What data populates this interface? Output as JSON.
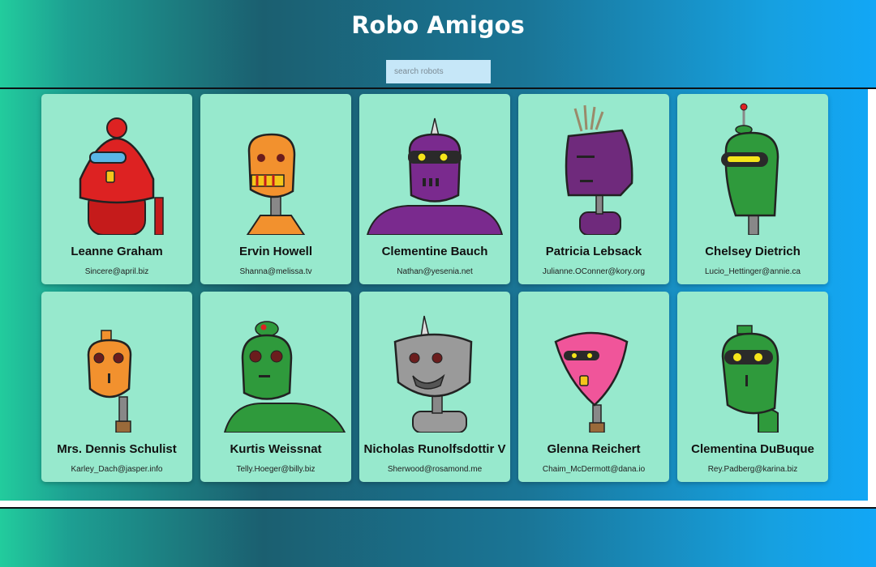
{
  "header": {
    "title": "Robo Amigos"
  },
  "search": {
    "placeholder": "search robots",
    "value": ""
  },
  "robots": [
    {
      "name": "Leanne Graham",
      "email": "Sincere@april.biz",
      "color": "#dd2222"
    },
    {
      "name": "Ervin Howell",
      "email": "Shanna@melissa.tv",
      "color": "#f2912e"
    },
    {
      "name": "Clementine Bauch",
      "email": "Nathan@yesenia.net",
      "color": "#7a2a8e"
    },
    {
      "name": "Patricia Lebsack",
      "email": "Julianne.OConner@kory.org",
      "color": "#6f2a7c"
    },
    {
      "name": "Chelsey Dietrich",
      "email": "Lucio_Hettinger@annie.ca",
      "color": "#2f9a3c"
    },
    {
      "name": "Mrs. Dennis Schulist",
      "email": "Karley_Dach@jasper.info",
      "color": "#f2912e"
    },
    {
      "name": "Kurtis Weissnat",
      "email": "Telly.Hoeger@billy.biz",
      "color": "#2f9a3c"
    },
    {
      "name": "Nicholas Runolfsdottir V",
      "email": "Sherwood@rosamond.me",
      "color": "#9a9a9a"
    },
    {
      "name": "Glenna Reichert",
      "email": "Chaim_McDermott@dana.io",
      "color": "#f0559a"
    },
    {
      "name": "Clementina DuBuque",
      "email": "Rey.Padberg@karina.biz",
      "color": "#2f9a3c"
    }
  ]
}
